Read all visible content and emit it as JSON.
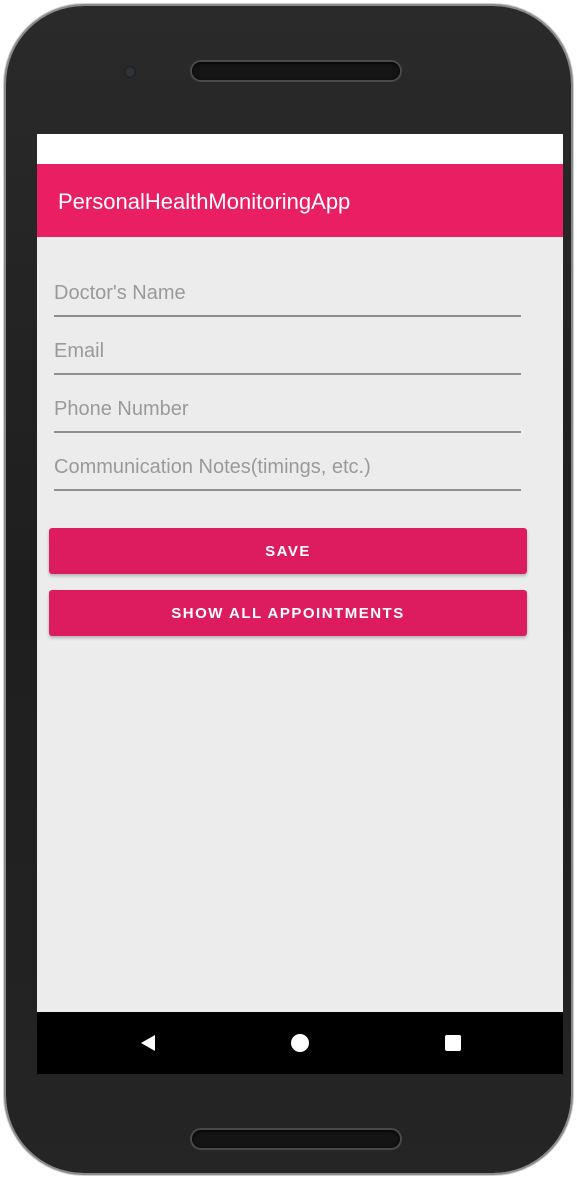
{
  "colors": {
    "accent": "#e91e63",
    "button": "#dc1c5f",
    "screen_background": "#ececec",
    "nav_bar": "#000000"
  },
  "app_bar": {
    "title": "PersonalHealthMonitoringApp"
  },
  "form": {
    "doctor_name": {
      "placeholder": "Doctor's Name",
      "value": ""
    },
    "email": {
      "placeholder": "Email",
      "value": ""
    },
    "phone": {
      "placeholder": "Phone Number",
      "value": ""
    },
    "notes": {
      "placeholder": "Communication Notes(timings, etc.)",
      "value": ""
    }
  },
  "buttons": {
    "save_label": "SAVE",
    "show_all_label": "SHOW ALL APPOINTMENTS"
  },
  "nav_bar": {
    "icons": [
      "back-icon",
      "home-icon",
      "recents-icon"
    ]
  }
}
